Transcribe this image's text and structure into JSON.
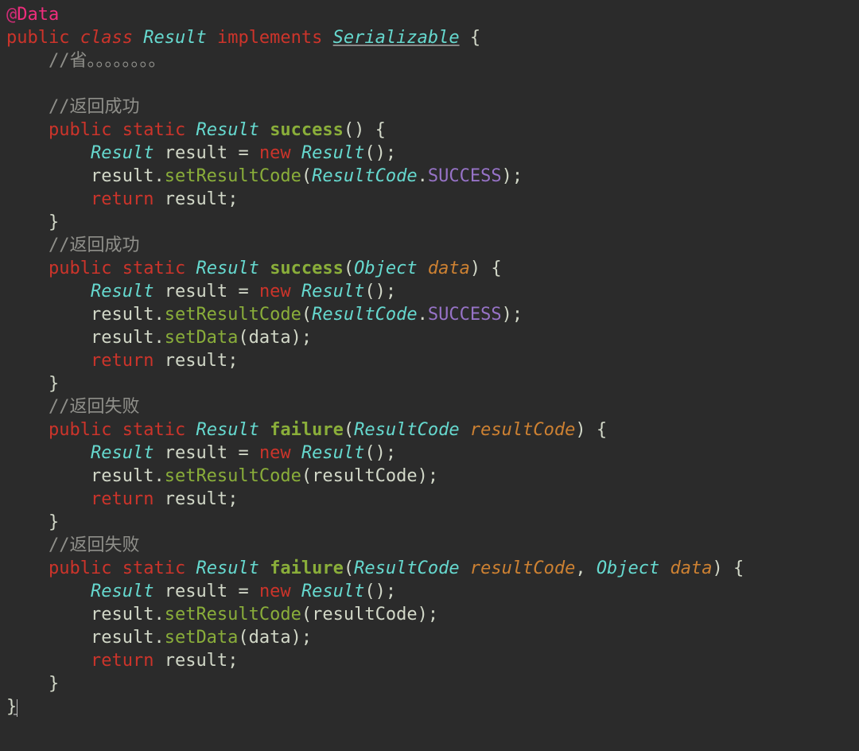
{
  "code": {
    "annotation_at": "@",
    "annotation_name": "Data",
    "kw_public": "public",
    "kw_class": "class",
    "kw_static": "static",
    "kw_new": "new",
    "kw_return": "return",
    "kw_implements": "implements",
    "type_result": "Result",
    "type_serializable": "Serializable",
    "type_object": "Object",
    "type_resultcode": "ResultCode",
    "const_success": "SUCCESS",
    "fn_success": "success",
    "fn_failure": "failure",
    "fn_setResultCode": "setResultCode",
    "fn_setData": "setData",
    "id_result": "result",
    "id_data": "data",
    "id_resultCode": "resultCode",
    "comment_omit": "//省。。。。。。。。",
    "comment_success": "//返回成功",
    "comment_failure": "//返回失败",
    "brace_open": "{",
    "brace_close": "}",
    "paren_open": "(",
    "paren_close": ")",
    "semicolon": ";",
    "dot": ".",
    "equals": "=",
    "comma": ","
  }
}
